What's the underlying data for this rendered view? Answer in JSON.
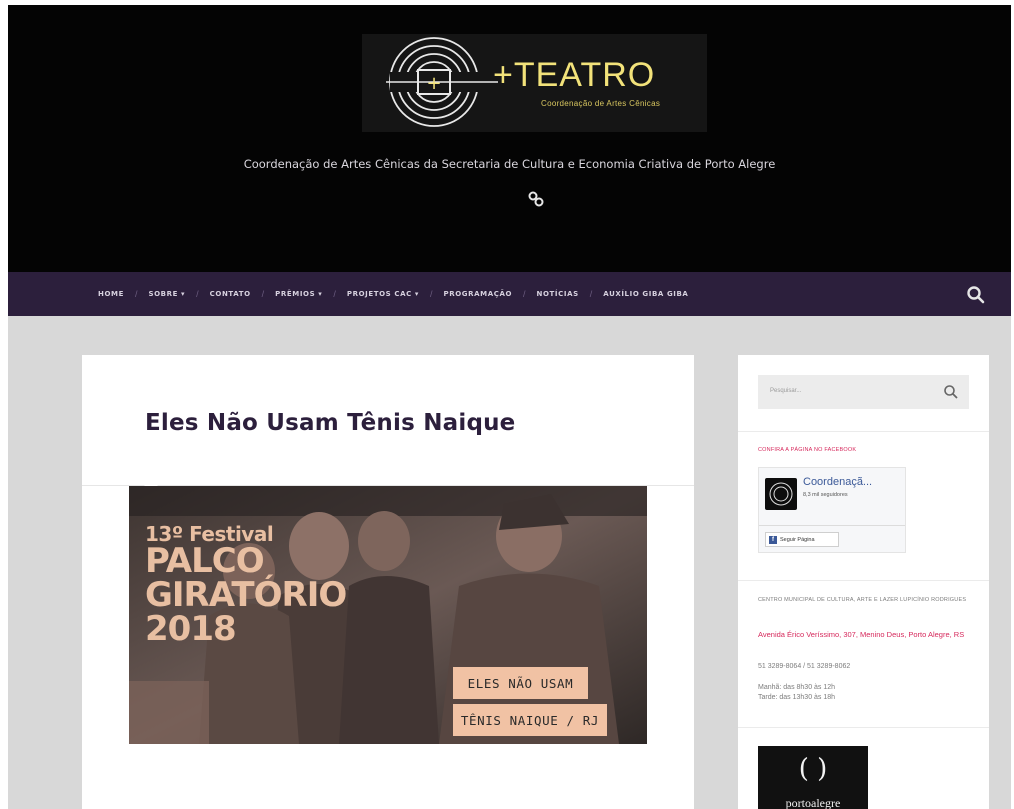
{
  "site": {
    "logo_title": "+TEATRO",
    "logo_subtitle": "Coordenação de Artes Cênicas",
    "tagline": "Coordenação de Artes Cênicas da Secretaria de Cultura e Economia Criativa de Porto Alegre"
  },
  "nav": {
    "items": [
      {
        "label": "HOME"
      },
      {
        "label": "SOBRE ▾"
      },
      {
        "label": "CONTATO"
      },
      {
        "label": "PRÊMIOS ▾"
      },
      {
        "label": "PROJETOS CAC ▾"
      },
      {
        "label": "PROGRAMAÇÃO"
      },
      {
        "label": "NOTÍCIAS"
      },
      {
        "label": "AUXÍLIO GIBA GIBA"
      }
    ],
    "separator": "/",
    "search_icon": "search-icon"
  },
  "post": {
    "title": "Eles Não Usam Tênis Naique",
    "image": {
      "festival_line1": "13º Festival",
      "festival_line2": "PALCO",
      "festival_line3": "GIRATÓRIO",
      "festival_year": "2018",
      "caption_line1": "ELES NÃO USAM",
      "caption_line2": "TÊNIS NAIQUE / RJ"
    }
  },
  "sidebar": {
    "search_placeholder": "Pesquisar...",
    "facebook": {
      "heading": "CONFIRA A PÁGINA NO FACEBOOK",
      "page_name": "Coordenaçã...",
      "followers": "8,3 mil seguidores",
      "follow_button": "Seguir Página"
    },
    "center_name": "CENTRO MUNICIPAL DE CULTURA, ARTE E LAZER LUPICÍNIO RODRIGUES",
    "address": "Avenida Érico Veríssimo, 307, Menino Deus, Porto Alegre, RS",
    "phone": "51 3289-8064 / 51 3289-8062",
    "hours_morning": "Manhã: das 8h30 às 12h",
    "hours_afternoon": "Tarde: das 13h30 às 18h",
    "sponsor_logo": {
      "symbol": "( )",
      "name": "portoalegre"
    }
  },
  "colors": {
    "header_bg": "#040404",
    "nav_bg": "#2c1f3c",
    "accent_pink": "#d6295c",
    "title_purple": "#2c1f3c",
    "caption_peach": "#f1c2a4"
  }
}
